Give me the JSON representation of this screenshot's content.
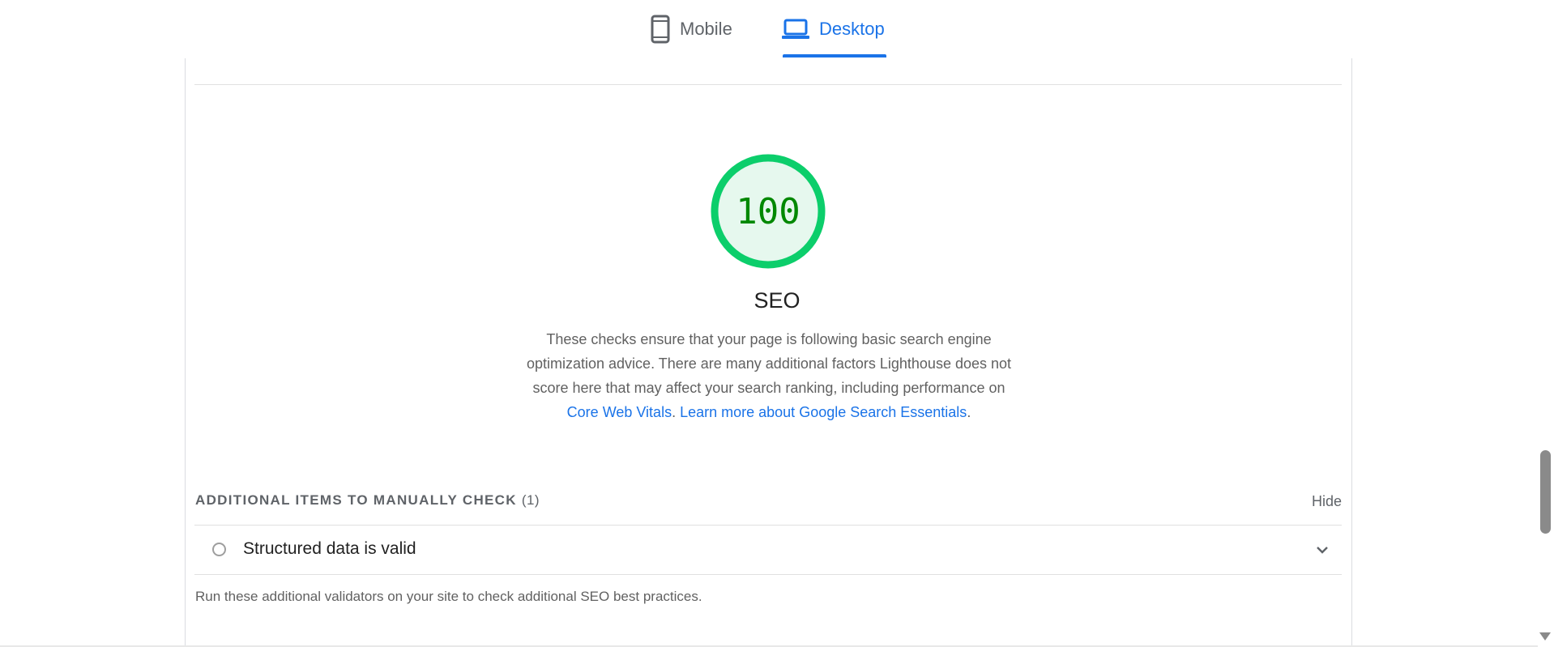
{
  "tabs": {
    "mobile": {
      "label": "Mobile",
      "icon": "smartphone-icon"
    },
    "desktop": {
      "label": "Desktop",
      "icon": "laptop-icon",
      "selected": true
    }
  },
  "category": {
    "score": "100",
    "score_fraction": 1.0,
    "title": "SEO",
    "description": "These checks ensure that your page is following basic search engine optimization advice. There are many additional factors Lighthouse does not score here that may affect your search ranking, including performance on",
    "link_core_web_vitals": "Core Web Vitals",
    "link_learn_more": "Learn more about Google Search Essentials"
  },
  "manual_group": {
    "header": "ADDITIONAL ITEMS TO MANUALLY CHECK",
    "count": "(1)",
    "toggle_label": "Hide",
    "audits": [
      {
        "title": "Structured data is valid"
      }
    ],
    "note": "Run these additional validators on your site to check additional SEO best practices."
  },
  "colors": {
    "pass_green": "#0cce6b",
    "pass_green_fill": "#e6f8ee",
    "score_text": "#008800",
    "accent_blue": "#1a73e8"
  }
}
